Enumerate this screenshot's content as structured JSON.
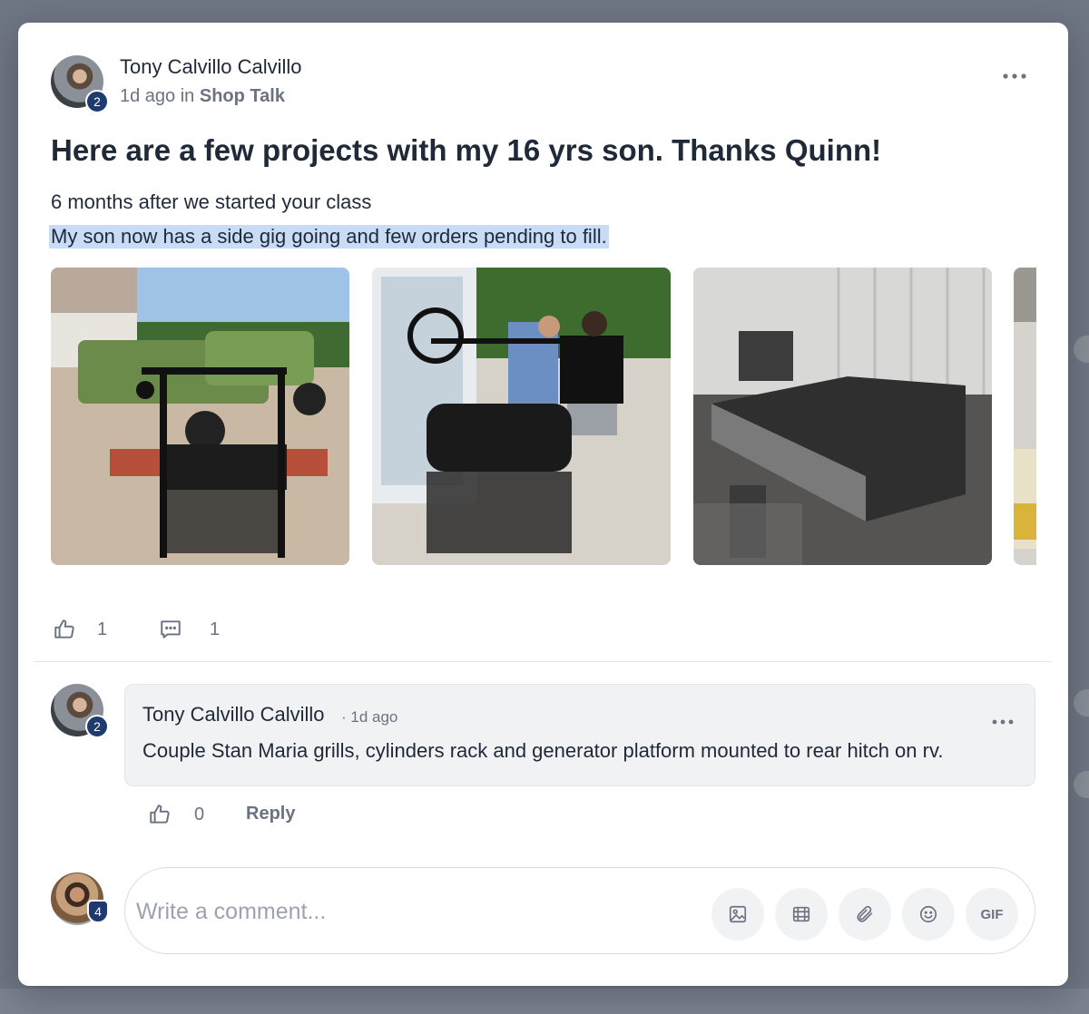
{
  "post": {
    "author": "Tony Calvillo Calvillo",
    "author_level": "2",
    "time": "1d ago",
    "in_word": "in",
    "space": "Shop Talk",
    "title": "Here are a few projects with my 16 yrs son. Thanks Quinn!",
    "body_line1": "6 months after we started your class",
    "body_line2": "My son now has a side gig going and few orders pending to fill.",
    "likes": "1",
    "comments": "1"
  },
  "comment": {
    "author": "Tony Calvillo Calvillo",
    "author_level": "2",
    "time": "1d ago",
    "text": "Couple Stan Maria grills, cylinders rack and generator platform mounted to rear hitch on rv.",
    "likes": "0",
    "reply_label": "Reply"
  },
  "composer": {
    "placeholder": "Write a comment...",
    "user_level": "4",
    "gif_label": "GIF"
  },
  "icons": {
    "more": "more-horizontal-icon",
    "like": "thumbs-up-icon",
    "comment": "comment-bubble-icon",
    "image": "image-icon",
    "video": "film-icon",
    "attach": "paperclip-icon",
    "emoji": "smiley-icon"
  },
  "colors": {
    "badge": "#1e3a6e",
    "highlight": "#c9dcf7"
  }
}
